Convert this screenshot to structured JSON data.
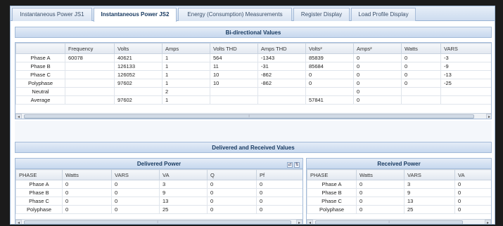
{
  "tabs": [
    {
      "label": "Instantaneous Power JS1",
      "active": false
    },
    {
      "label": "Instantaneous Power JS2",
      "active": true
    },
    {
      "label": "Energy (Consumption) Measurements",
      "active": false
    },
    {
      "label": "Register Display",
      "active": false
    },
    {
      "label": "Load Profile Display",
      "active": false
    }
  ],
  "bidirectional": {
    "title": "Bi-directional Values",
    "columns": [
      "",
      "Frequency",
      "Volts",
      "Amps",
      "Volts THD",
      "Amps THD",
      "Volts²",
      "Amps²",
      "Watts",
      "VARS"
    ],
    "rows": [
      [
        "Phase A",
        "60078",
        "40621",
        "1",
        "564",
        "-1343",
        "85839",
        "0",
        "0",
        "-3"
      ],
      [
        "Phase B",
        "",
        "126133",
        "1",
        "11",
        "-31",
        "85684",
        "0",
        "0",
        "-9"
      ],
      [
        "Phase C",
        "",
        "126052",
        "1",
        "10",
        "-862",
        "0",
        "0",
        "0",
        "-13"
      ],
      [
        "Polyphase",
        "",
        "97602",
        "1",
        "10",
        "-862",
        "0",
        "0",
        "0",
        "-25"
      ],
      [
        "Neutral",
        "",
        "",
        "2",
        "",
        "",
        "",
        "0",
        "",
        ""
      ],
      [
        "Average",
        "",
        "97602",
        "1",
        "",
        "",
        "57841",
        "0",
        "",
        ""
      ]
    ]
  },
  "delivered_received_title": "Delivered and Received Values",
  "delivered": {
    "title": "Delivered Power",
    "columns": [
      "PHASE",
      "Watts",
      "VARS",
      "VA",
      "Q",
      "Pf"
    ],
    "rows": [
      [
        "Phase A",
        "0",
        "0",
        "3",
        "0",
        "0"
      ],
      [
        "Phase B",
        "0",
        "0",
        "9",
        "0",
        "0"
      ],
      [
        "Phase C",
        "0",
        "0",
        "13",
        "0",
        "0"
      ],
      [
        "Polyphase",
        "0",
        "0",
        "25",
        "0",
        "0"
      ]
    ]
  },
  "received": {
    "title": "Received Power",
    "columns": [
      "PHASE",
      "Watts",
      "VARS",
      "VA"
    ],
    "rows": [
      [
        "Phase A",
        "0",
        "3",
        "0"
      ],
      [
        "Phase B",
        "0",
        "9",
        "0"
      ],
      [
        "Phase C",
        "0",
        "13",
        "0"
      ],
      [
        "Polyphase",
        "0",
        "25",
        "0"
      ]
    ]
  },
  "icons": {
    "scroll_left": "◂",
    "scroll_right": "▸",
    "grip": "⦙",
    "panel_tool_a": "⇄",
    "panel_tool_b": "⇅"
  }
}
